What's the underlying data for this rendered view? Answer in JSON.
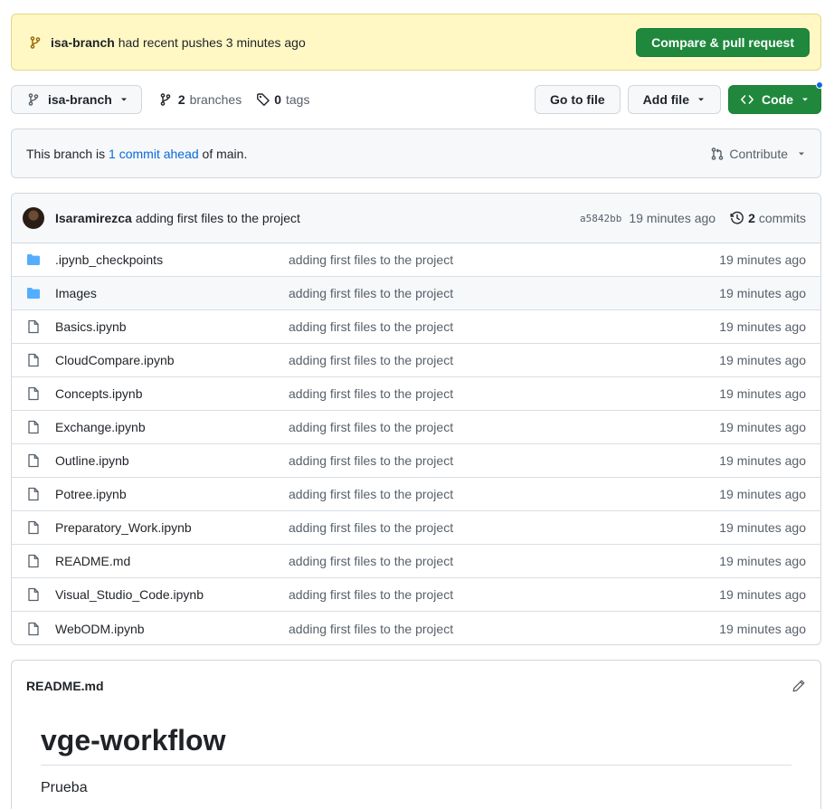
{
  "banner": {
    "branch": "isa-branch",
    "message": " had recent pushes 3 minutes ago",
    "compare_button": "Compare & pull request"
  },
  "toolbar": {
    "branch_select": "isa-branch",
    "branches_count": "2",
    "branches_label": "branches",
    "tags_count": "0",
    "tags_label": "tags",
    "goto_file": "Go to file",
    "add_file": "Add file",
    "code": "Code"
  },
  "ahead": {
    "prefix": "This branch is ",
    "link": "1 commit ahead",
    "suffix": " of main.",
    "contribute": "Contribute"
  },
  "commit": {
    "author": "Isaramirezca",
    "message": "adding first files to the project",
    "sha": "a5842bb",
    "time": "19 minutes ago",
    "count": "2",
    "count_label": "commits"
  },
  "files": [
    {
      "name": ".ipynb_checkpoints",
      "type": "folder",
      "message": "adding first files to the project",
      "age": "19 minutes ago"
    },
    {
      "name": "Images",
      "type": "folder",
      "message": "adding first files to the project",
      "age": "19 minutes ago"
    },
    {
      "name": "Basics.ipynb",
      "type": "file",
      "message": "adding first files to the project",
      "age": "19 minutes ago"
    },
    {
      "name": "CloudCompare.ipynb",
      "type": "file",
      "message": "adding first files to the project",
      "age": "19 minutes ago"
    },
    {
      "name": "Concepts.ipynb",
      "type": "file",
      "message": "adding first files to the project",
      "age": "19 minutes ago"
    },
    {
      "name": "Exchange.ipynb",
      "type": "file",
      "message": "adding first files to the project",
      "age": "19 minutes ago"
    },
    {
      "name": "Outline.ipynb",
      "type": "file",
      "message": "adding first files to the project",
      "age": "19 minutes ago"
    },
    {
      "name": "Potree.ipynb",
      "type": "file",
      "message": "adding first files to the project",
      "age": "19 minutes ago"
    },
    {
      "name": "Preparatory_Work.ipynb",
      "type": "file",
      "message": "adding first files to the project",
      "age": "19 minutes ago"
    },
    {
      "name": "README.md",
      "type": "file",
      "message": "adding first files to the project",
      "age": "19 minutes ago"
    },
    {
      "name": "Visual_Studio_Code.ipynb",
      "type": "file",
      "message": "adding first files to the project",
      "age": "19 minutes ago"
    },
    {
      "name": "WebODM.ipynb",
      "type": "file",
      "message": "adding first files to the project",
      "age": "19 minutes ago"
    }
  ],
  "readme": {
    "filename": "README.md",
    "heading": "vge-workflow",
    "body": "Prueba"
  },
  "colors": {
    "accent_green": "#1f883d",
    "link_blue": "#0969da",
    "folder_blue": "#54aeff",
    "banner_bg": "#fff8c5"
  }
}
